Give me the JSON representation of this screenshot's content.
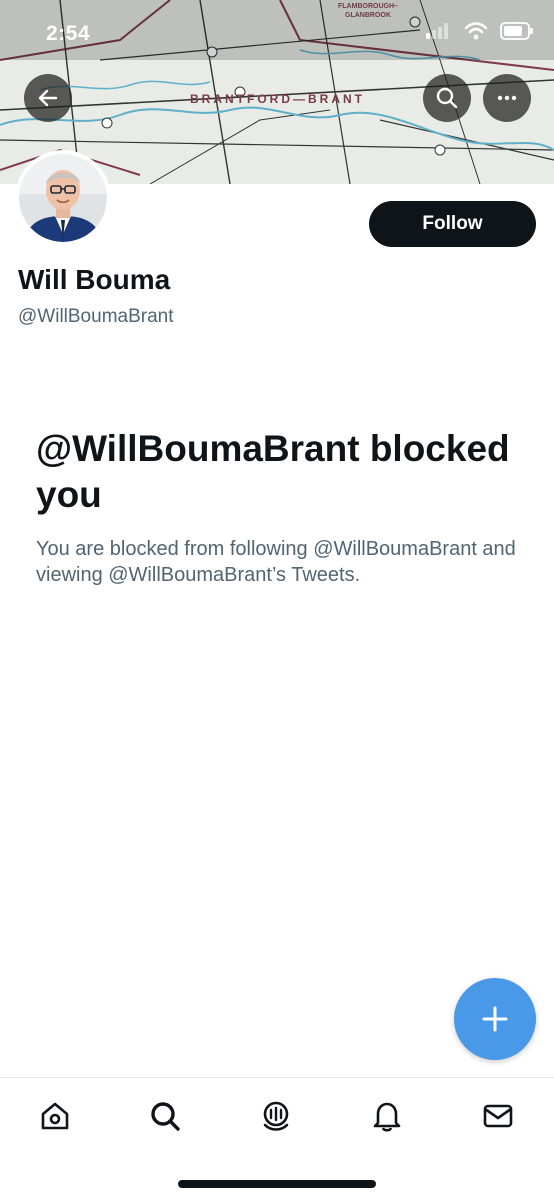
{
  "status_bar": {
    "time": "2:54"
  },
  "banner": {
    "map_label_main": "BRANTFORD—BRANT",
    "map_label_top_line1": "FLAMBOROUGH–",
    "map_label_top_line2": "GLANBROOK"
  },
  "profile": {
    "display_name": "Will Bouma",
    "handle": "@WillBoumaBrant",
    "follow_label": "Follow"
  },
  "blocked": {
    "title": "@WillBoumaBrant blocked you",
    "description": "You are blocked from following @WillBoumaBrant and viewing @WillBoumaBrant’s Tweets."
  },
  "tabs": [
    "home-icon",
    "search-icon",
    "spaces-icon",
    "notifications-icon",
    "messages-icon"
  ],
  "colors": {
    "accent": "#4a99e9",
    "follow_bg": "#0f1419",
    "secondary_text": "#536471"
  }
}
